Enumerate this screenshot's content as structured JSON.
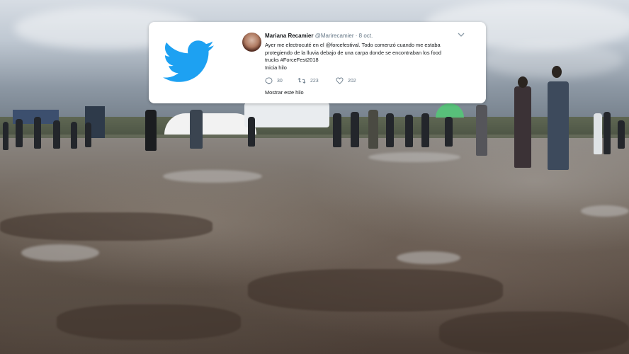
{
  "tweet": {
    "author_name": "Mariana Recamier",
    "author_handle": "@Marirecamier",
    "date": "8 oct.",
    "text_lines": [
      "Ayer me electrocuté en el @forcefestival. Todo comenzó cuando me estaba",
      "protegiendo de la lluvia debajo de una carpa donde se encontraban los food",
      "trucks #ForceFest2018",
      "Inicia hilo"
    ],
    "actions": {
      "replies": "30",
      "retweets": "223",
      "likes": "202"
    },
    "show_thread": "Mostrar este hilo"
  },
  "icons": {
    "logo": "twitter-bird-icon",
    "reply": "reply-icon",
    "retweet": "retweet-icon",
    "like": "heart-icon",
    "more": "chevron-down-icon"
  },
  "colors": {
    "twitter_blue": "#1da1f2",
    "text_primary": "#14171a",
    "text_secondary": "#657786"
  }
}
